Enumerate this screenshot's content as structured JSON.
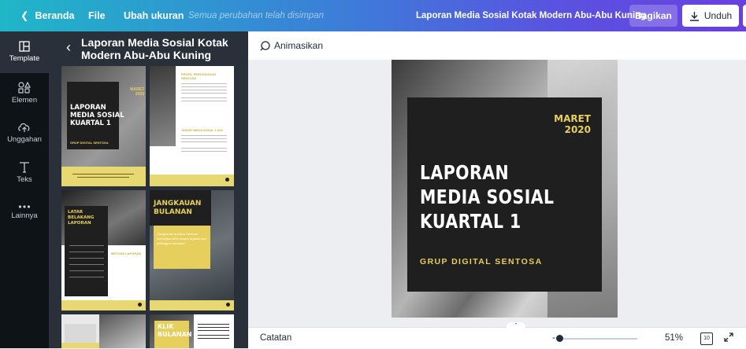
{
  "topbar": {
    "home_label": "Beranda",
    "file_label": "File",
    "resize_label": "Ubah ukuran",
    "saved_status": "Semua perubahan telah disimpan",
    "design_title": "Laporan Media Sosial Kotak Modern Abu-Abu Kuning",
    "share_label": "Bagikan",
    "download_label": "Unduh"
  },
  "sidebar": {
    "items": [
      {
        "label": "Template",
        "icon": "template-icon"
      },
      {
        "label": "Elemen",
        "icon": "elements-icon"
      },
      {
        "label": "Unggahan",
        "icon": "upload-icon"
      },
      {
        "label": "Teks",
        "icon": "text-icon"
      },
      {
        "label": "Lainnya",
        "icon": "more-icon"
      }
    ]
  },
  "panel": {
    "title": "Laporan Media Sosial Kotak Modern Abu-Abu Kuning",
    "thumbs": {
      "t1": {
        "month": "MARET 2020",
        "title": "LAPORAN MEDIA SOSIAL KUARTAL 1",
        "company": "GRUP DIGITAL SENTOSA"
      },
      "t2": {
        "heading": "PROFIL PERUSAHAAN SENTOSA",
        "heading2": "TARGET MEDIA SOSIAL 1 2020"
      },
      "t3": {
        "heading": "LATAR BELAKANG LAPORAN",
        "sub": "METODE LAPORAN"
      },
      "t4": {
        "heading": "JANGKAUAN BULANAN",
        "quote": "\"Jangkauan audiens Sentosa meningkat 60% secara organik dan pelanggan bertanya\""
      },
      "t6": {
        "heading": "KLIK BULANAN"
      }
    }
  },
  "canvas": {
    "animate_label": "Animasikan",
    "page": {
      "month_line1": "MARET",
      "month_line2": "2020",
      "title_line1": "LAPORAN",
      "title_line2": "MEDIA SOSIAL",
      "title_line3": "KUARTAL 1",
      "company": "GRUP DIGITAL SENTOSA"
    }
  },
  "bottombar": {
    "notes_label": "Catatan",
    "zoom_minus": "-",
    "zoom_value": "51%",
    "zoom_fraction": 0.05,
    "page_count": "10"
  },
  "colors": {
    "accent_yellow": "#e6cf5c",
    "dark_panel": "#293039",
    "rail": "#0e1318"
  }
}
